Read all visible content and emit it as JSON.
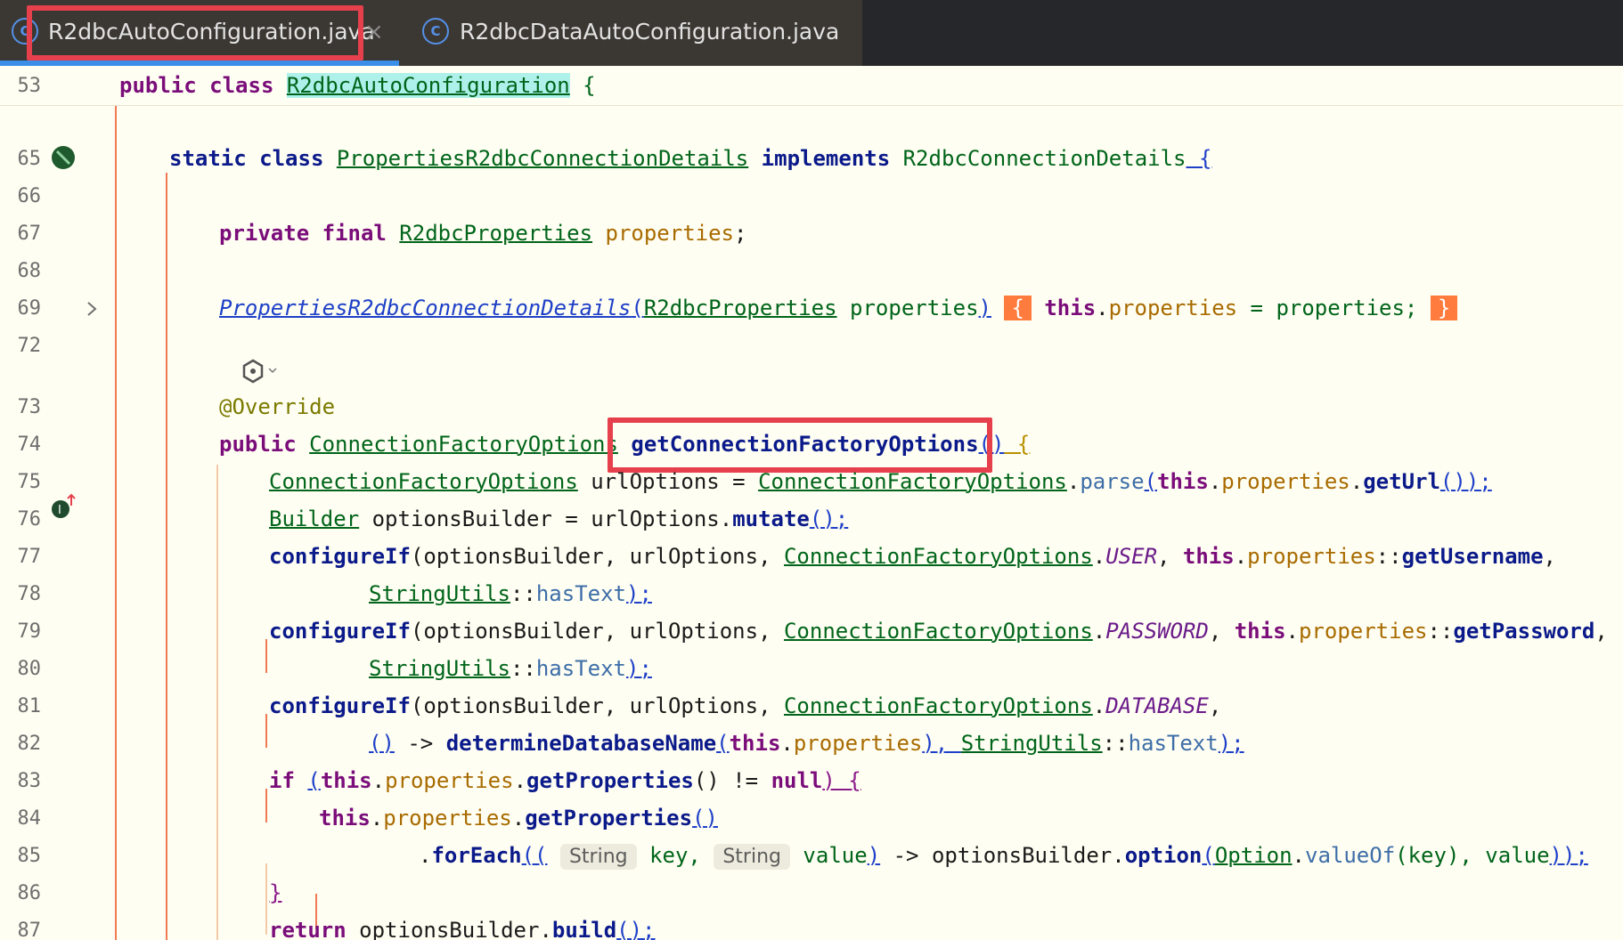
{
  "tabs": [
    {
      "label": "R2dbcAutoConfiguration.java",
      "icon": "class-icon",
      "active": true,
      "close": "×"
    },
    {
      "label": "R2dbcDataAutoConfiguration.java",
      "icon": "class-icon",
      "active": false
    }
  ],
  "gutter": {
    "line_numbers": [
      "53",
      "65",
      "66",
      "67",
      "68",
      "69",
      "72",
      "73",
      "74",
      "75",
      "76",
      "77",
      "78",
      "79",
      "80",
      "81",
      "82",
      "83",
      "84",
      "85",
      "86",
      "87"
    ]
  },
  "code": {
    "l53": {
      "kw1": "public class ",
      "cls": "R2dbcAutoConfiguration",
      "tail": " {"
    },
    "l65": {
      "kw1": "static class ",
      "cls": "PropertiesR2dbcConnectionDetails",
      "kw2": " implements ",
      "iface": "R2dbcConnectionDetails",
      "tail": " {"
    },
    "l67": {
      "kw": "private final ",
      "cls": "R2dbcProperties",
      "fld": " properties",
      "tail": ";"
    },
    "l69": {
      "ctor": "PropertiesR2dbcConnectionDetails",
      "open": "(",
      "cls": "R2dbcProperties",
      "param": " properties",
      "close": ")",
      "lbrace": "{",
      "kw": "this",
      "dot": ".",
      "fld": "properties",
      "assign": " = properties;",
      "rbrace": "}"
    },
    "l73": {
      "anno": "@Override"
    },
    "l74": {
      "kw": "public ",
      "cls": "ConnectionFactoryOptions",
      "meth": "getConnectionFactoryOptions",
      "parens": "()",
      "tail": " {"
    },
    "l75": {
      "cls": "ConnectionFactoryOptions",
      "mid": " urlOptions = ",
      "cls2": "ConnectionFactoryOptions",
      "dot": ".",
      "smeth": "parse",
      "open": "(",
      "kw": "this",
      "dot2": ".",
      "fld": "properties",
      "dot3": ".",
      "meth": "getUrl",
      "tail": "());"
    },
    "l76": {
      "cls": "Builder",
      "mid": " optionsBuilder = urlOptions.",
      "meth": "mutate",
      "tail": "();"
    },
    "l77": {
      "meth": "configureIf",
      "mid": "(optionsBuilder, urlOptions, ",
      "cls": "ConnectionFactoryOptions",
      "dot": ".",
      "stat": "USER",
      "sep": ", ",
      "kw": "this",
      "dot2": ".",
      "fld": "properties",
      "cc": "::",
      "meth2": "getUsername",
      "tail": ","
    },
    "l78": {
      "cls": "StringUtils",
      "cc": "::",
      "smeth": "hasText",
      "tail": ");"
    },
    "l79": {
      "meth": "configureIf",
      "mid": "(optionsBuilder, urlOptions, ",
      "cls": "ConnectionFactoryOptions",
      "dot": ".",
      "stat": "PASSWORD",
      "sep": ", ",
      "kw": "this",
      "dot2": ".",
      "fld": "properties",
      "cc": "::",
      "meth2": "getPassword",
      "tail": ","
    },
    "l80": {
      "cls": "StringUtils",
      "cc": "::",
      "smeth": "hasText",
      "tail": ");"
    },
    "l81": {
      "meth": "configureIf",
      "mid": "(optionsBuilder, urlOptions, ",
      "cls": "ConnectionFactoryOptions",
      "dot": ".",
      "stat": "DATABASE",
      "tail": ","
    },
    "l82": {
      "parens": "()",
      "arrow": " -> ",
      "meth": "determineDatabaseName",
      "open": "(",
      "kw": "this",
      "dot": ".",
      "fld": "properties",
      "close": "), ",
      "cls": "StringUtils",
      "cc": "::",
      "smeth": "hasText",
      "tail": ");"
    },
    "l83": {
      "kw": "if ",
      "open": "(",
      "kw2": "this",
      "dot": ".",
      "fld": "properties",
      "dot2": ".",
      "meth": "getProperties",
      "mid": "() != ",
      "kw3": "null",
      "tail": ") {"
    },
    "l84": {
      "kw": "this",
      "dot": ".",
      "fld": "properties",
      "dot2": ".",
      "meth": "getProperties",
      "tail": "()"
    },
    "l85": {
      "dot": ".",
      "meth": "forEach",
      "open": "((",
      "hint1": "String",
      "p1": " key, ",
      "hint2": "String",
      "p2": " value",
      "close": ")",
      "arrow": " -> optionsBuilder.",
      "meth2": "option",
      "open2": "(",
      "cls": "Option",
      "dot2": ".",
      "smeth": "valueOf",
      "args": "(key), value",
      "tail": "));"
    },
    "l86": {
      "tail": "}"
    },
    "l87": {
      "kw": "return ",
      "mid": "optionsBuilder.",
      "meth": "build",
      "tail": "();"
    }
  },
  "colors": {
    "highlight_box": "#e5404c",
    "brace_highlight": "#ff7b3e",
    "tab_accent": "#3b8ee8",
    "editor_bg": "#fffef2"
  }
}
